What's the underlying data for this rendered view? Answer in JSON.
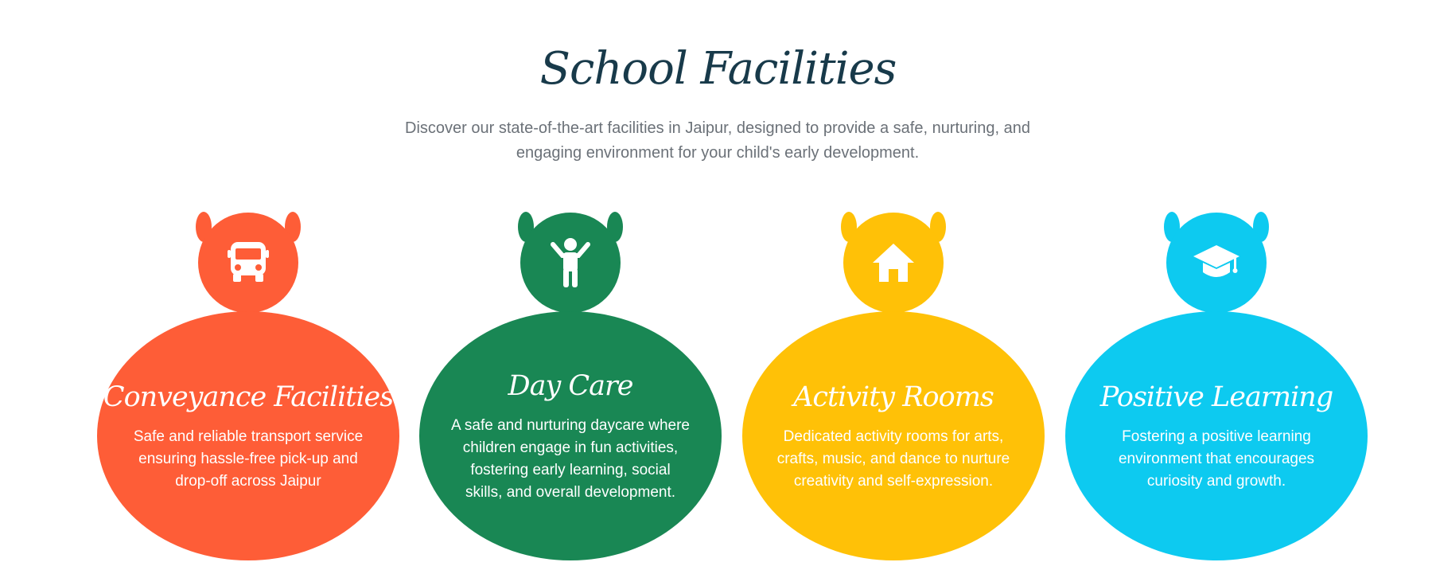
{
  "section": {
    "title": "School Facilities",
    "subtitle": "Discover our state-of-the-art facilities in Jaipur, designed to provide a safe, nurturing, and engaging environment for your child's early development."
  },
  "cards": [
    {
      "title": "Conveyance Facilities",
      "description": "Safe and reliable transport service ensuring hassle-free pick-up and drop-off across Jaipur",
      "icon": "bus-icon",
      "color": "#fe5d37"
    },
    {
      "title": "Day Care",
      "description": "A safe and nurturing daycare where children engage in fun activities, fostering early learning, social skills, and overall development.",
      "icon": "child-icon",
      "color": "#198754"
    },
    {
      "title": "Activity Rooms",
      "description": "Dedicated activity rooms for arts, crafts, music, and dance to nurture creativity and self-expression.",
      "icon": "home-icon",
      "color": "#ffc107"
    },
    {
      "title": "Positive Learning",
      "description": "Fostering a positive learning environment that encourages curiosity and growth.",
      "icon": "graduation-cap-icon",
      "color": "#0dcaf0"
    }
  ]
}
